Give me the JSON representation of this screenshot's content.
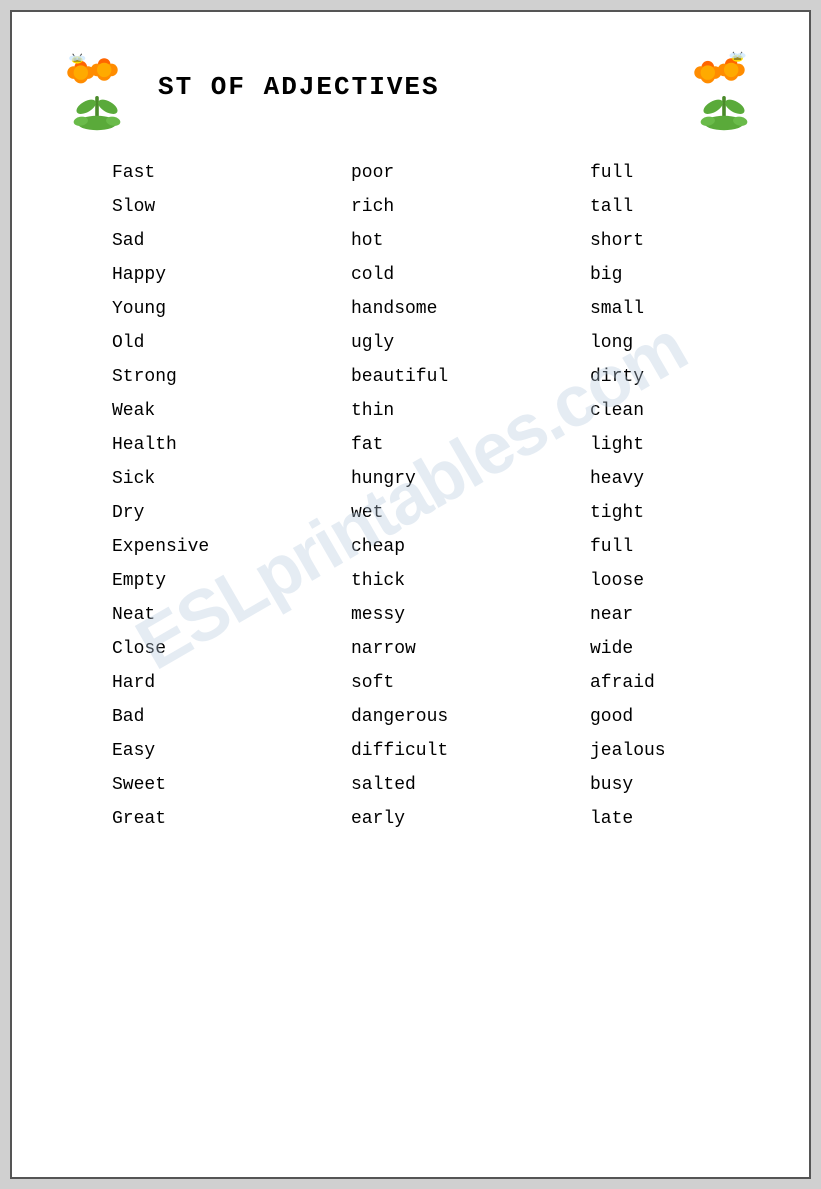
{
  "title": "ST OF ADJECTIVES",
  "watermark": "ESLprintables.com",
  "words": [
    [
      "Fast",
      "poor",
      "full"
    ],
    [
      "Slow",
      "rich",
      "tall"
    ],
    [
      "Sad",
      "hot",
      "short"
    ],
    [
      "Happy",
      "cold",
      "big"
    ],
    [
      "Young",
      "handsome",
      "small"
    ],
    [
      "Old",
      "ugly",
      "long"
    ],
    [
      "Strong",
      "beautiful",
      "dirty"
    ],
    [
      "Weak",
      "thin",
      "clean"
    ],
    [
      "Health",
      "fat",
      "light"
    ],
    [
      "Sick",
      "hungry",
      "heavy"
    ],
    [
      "Dry",
      "wet",
      "tight"
    ],
    [
      "Expensive",
      "cheap",
      "full"
    ],
    [
      "Empty",
      "thick",
      "loose"
    ],
    [
      "Neat",
      "messy",
      "near"
    ],
    [
      "Close",
      "narrow",
      "wide"
    ],
    [
      "Hard",
      "soft",
      "afraid"
    ],
    [
      "Bad",
      "dangerous",
      "good"
    ],
    [
      "Easy",
      "difficult",
      "jealous"
    ],
    [
      "Sweet",
      "salted",
      "busy"
    ],
    [
      "Great",
      "early",
      "late"
    ]
  ]
}
